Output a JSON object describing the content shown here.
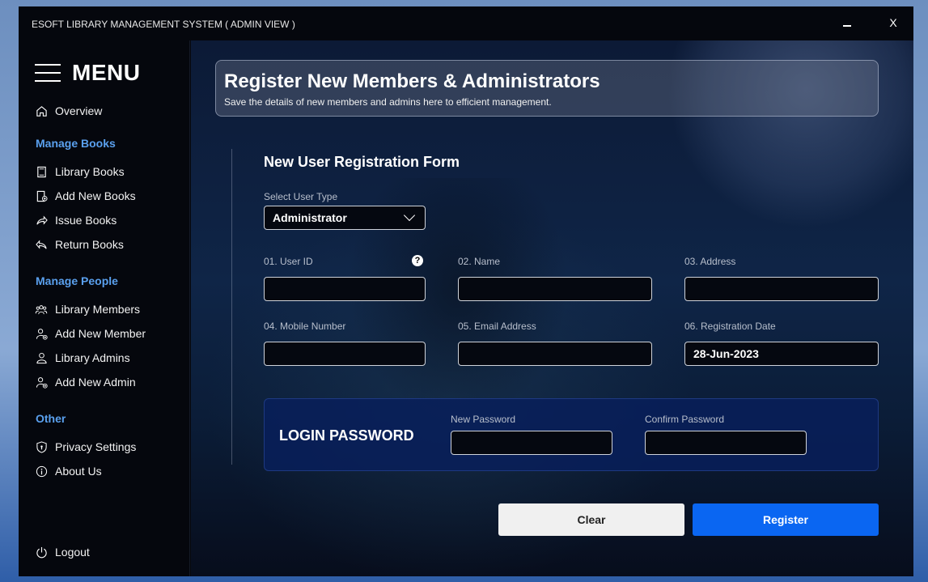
{
  "window": {
    "title": "ESOFT LIBRARY MANAGEMENT SYSTEM ( ADMIN VIEW )",
    "close_label": "X"
  },
  "sidebar": {
    "menu_label": "MENU",
    "overview": "Overview",
    "sections": {
      "books": "Manage Books",
      "people": "Manage People",
      "other": "Other"
    },
    "items": {
      "library_books": "Library Books",
      "add_new_books": "Add New Books",
      "issue_books": "Issue Books",
      "return_books": "Return Books",
      "library_members": "Library Members",
      "add_new_member": "Add New Member",
      "library_admins": "Library Admins",
      "add_new_admin": "Add New Admin",
      "privacy_settings": "Privacy Settings",
      "about_us": "About Us",
      "logout": "Logout"
    }
  },
  "banner": {
    "title": "Register New Members & Administrators",
    "subtitle": "Save the details of new members and admins here to efficient management."
  },
  "form": {
    "title": "New User Registration Form",
    "user_type_label": "Select User Type",
    "user_type_value": "Administrator",
    "fields": {
      "user_id": {
        "label": "01. User ID",
        "value": ""
      },
      "name": {
        "label": "02. Name",
        "value": ""
      },
      "address": {
        "label": "03. Address",
        "value": ""
      },
      "mobile": {
        "label": "04. Mobile Number",
        "value": ""
      },
      "email": {
        "label": "05. Email Address",
        "value": ""
      },
      "reg_date": {
        "label": "06. Registration Date",
        "value": "28-Jun-2023"
      }
    },
    "help_glyph": "?",
    "password": {
      "title": "LOGIN PASSWORD",
      "new_label": "New Password",
      "confirm_label": "Confirm Password"
    },
    "buttons": {
      "clear": "Clear",
      "register": "Register"
    }
  },
  "colors": {
    "accent": "#0a66f2",
    "section_heading": "#5aa0ee",
    "window_bg": "#05070d"
  }
}
